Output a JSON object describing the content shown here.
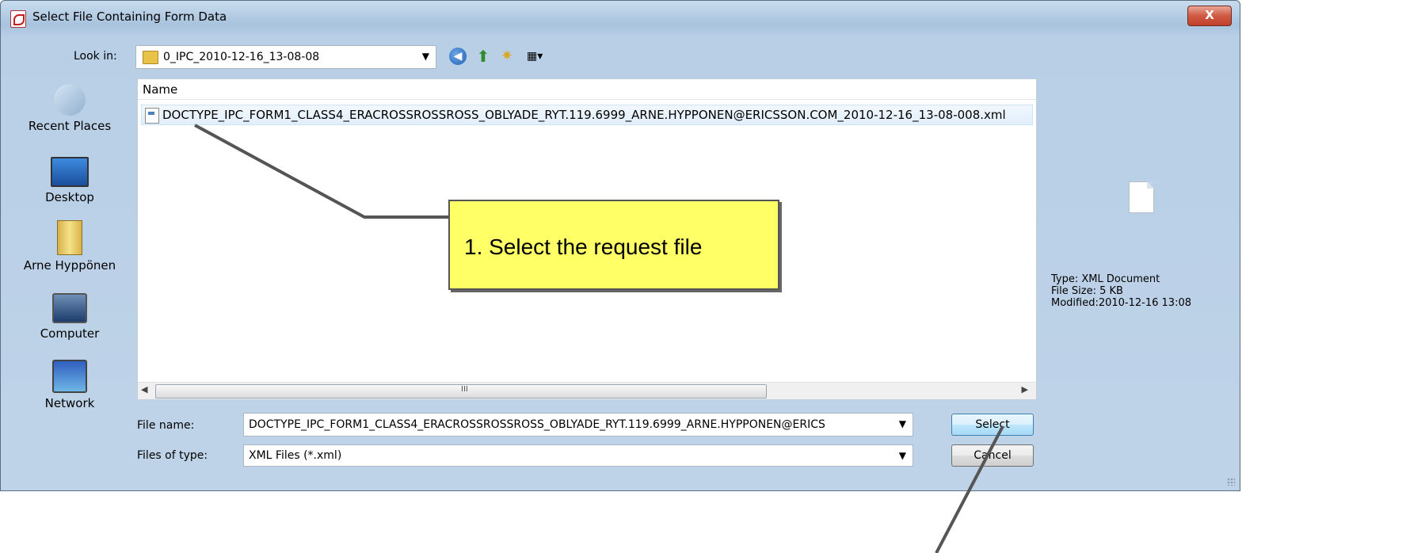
{
  "window": {
    "title": "Select File Containing Form Data",
    "close_label": "X"
  },
  "toolbar": {
    "look_in_label": "Look in:",
    "look_in_value": "0_IPC_2010-12-16_13-08-08",
    "icons": [
      "back-icon",
      "up-folder-icon",
      "new-folder-icon",
      "views-menu-icon"
    ]
  },
  "places": [
    {
      "label": "Recent Places",
      "icon": "recent-places-icon"
    },
    {
      "label": "Desktop",
      "icon": "desktop-icon"
    },
    {
      "label": "Arne Hyppönen",
      "icon": "user-folder-icon"
    },
    {
      "label": "Computer",
      "icon": "computer-icon"
    },
    {
      "label": "Network",
      "icon": "network-icon"
    }
  ],
  "file_list": {
    "column_name": "Name",
    "files": [
      {
        "name": "DOCTYPE_IPC_FORM1_CLASS4_ERACROSSROSSROSS_OBLYADE_RYT.119.6999_ARNE.HYPPONEN@ERICSSON.COM_2010-12-16_13-08-008.xml",
        "selected": true
      }
    ],
    "scroll_grip": "III"
  },
  "preview": {
    "type": "Type: XML Document",
    "size": "File Size: 5 KB",
    "modified": "Modified:2010-12-16 13:08"
  },
  "form": {
    "file_name_label": "File name:",
    "file_name_value": "DOCTYPE_IPC_FORM1_CLASS4_ERACROSSROSSROSS_OBLYADE_RYT.119.6999_ARNE.HYPPONEN@ERICS",
    "file_type_label": "Files of type:",
    "file_type_value": "XML Files (*.xml)",
    "select_button": "Select",
    "cancel_button": "Cancel"
  },
  "annotation": {
    "callout_text": "1. Select the request file",
    "callout_color": "#ffff66"
  }
}
